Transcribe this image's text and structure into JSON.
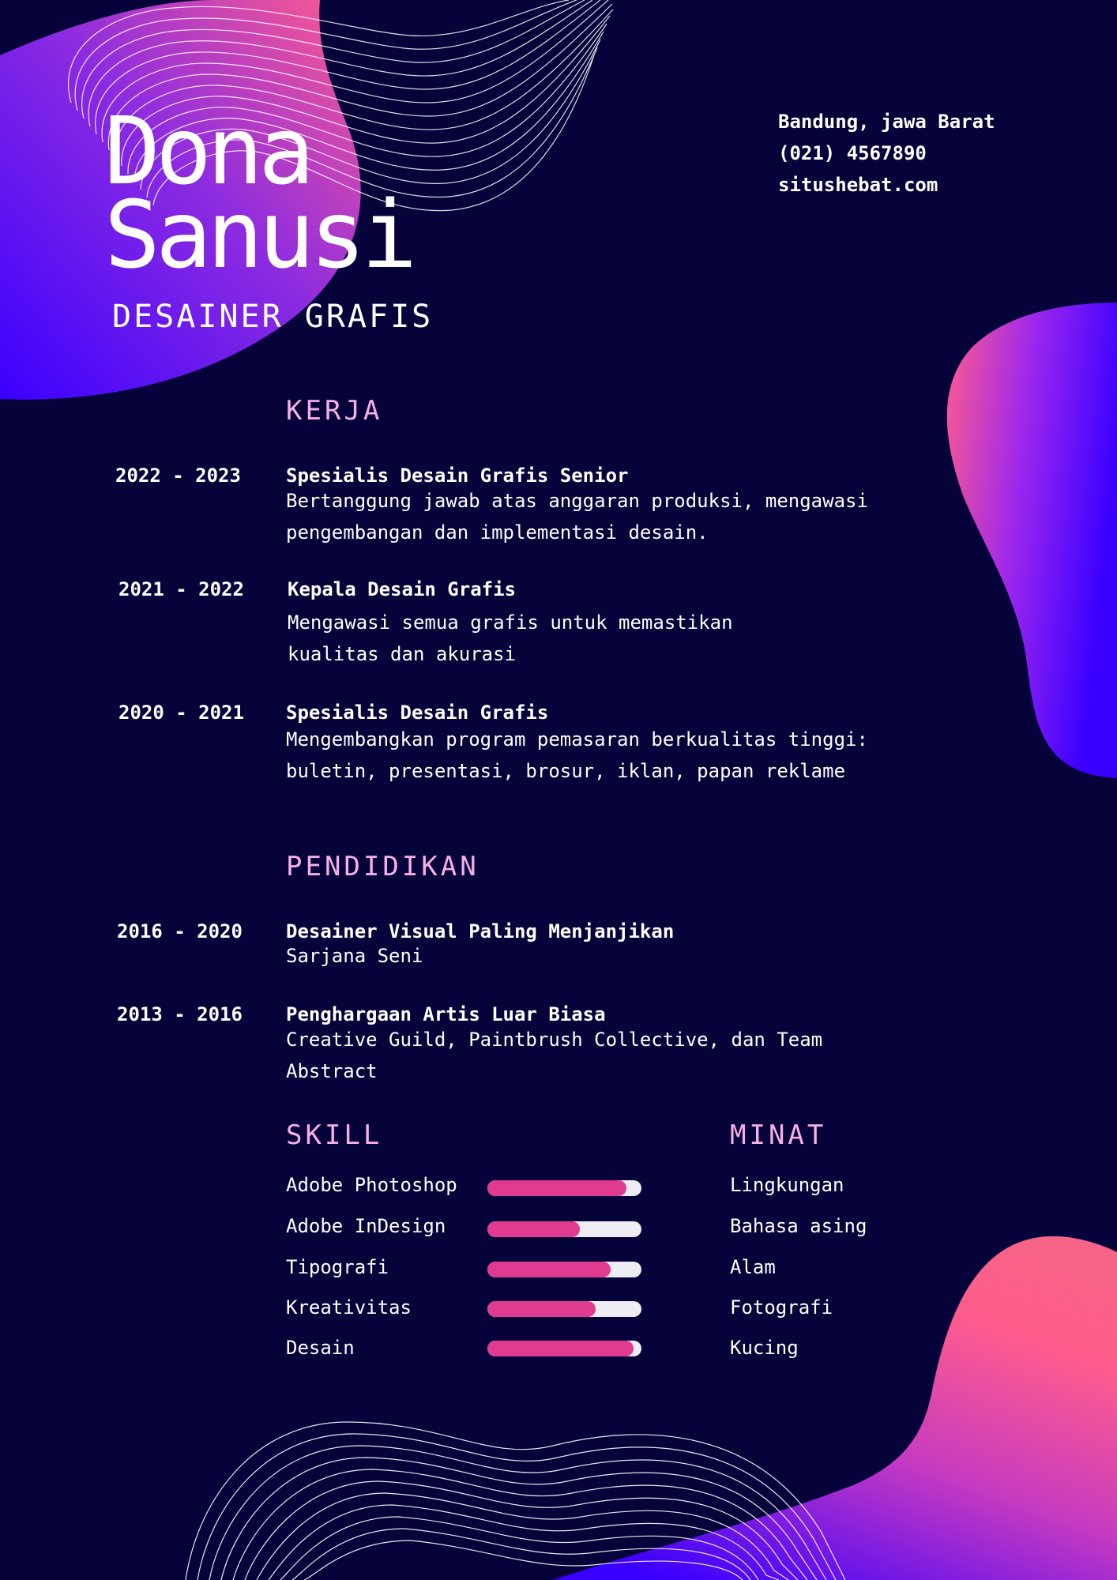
{
  "header": {
    "first_name": "Dona",
    "last_name": "Sanusi",
    "role": "DESAINER GRAFIS"
  },
  "contact": {
    "location": "Bandung, jawa Barat",
    "phone": "(021) 4567890",
    "website": "situshebat.com"
  },
  "work": {
    "title": "KERJA",
    "items": [
      {
        "years": "2022 - 2023",
        "title": "Spesialis Desain Grafis Senior",
        "desc": [
          "Bertanggung jawab atas anggaran produksi, mengawasi",
          "pengembangan dan implementasi desain."
        ]
      },
      {
        "years": "2021 - 2022",
        "title": "Kepala Desain Grafis",
        "desc": [
          "Mengawasi semua grafis untuk memastikan",
          "kualitas dan akurasi"
        ]
      },
      {
        "years": "2020 - 2021",
        "title": "Spesialis Desain Grafis",
        "desc": [
          "Mengembangkan program pemasaran berkualitas tinggi:",
          "buletin, presentasi, brosur, iklan, papan reklame"
        ]
      }
    ]
  },
  "education": {
    "title": "PENDIDIKAN",
    "items": [
      {
        "years": "2016 - 2020",
        "title": "Desainer Visual Paling Menjanjikan",
        "desc": [
          "Sarjana Seni"
        ]
      },
      {
        "years": "2013 - 2016",
        "title": "Penghargaan Artis Luar Biasa",
        "desc": [
          "Creative Guild, Paintbrush Collective, dan Team",
          "Abstract"
        ]
      }
    ]
  },
  "skills": {
    "title": "SKILL",
    "items": [
      {
        "label": "Adobe Photoshop",
        "level": 0.9
      },
      {
        "label": "Adobe InDesign",
        "level": 0.6
      },
      {
        "label": "Tipografi",
        "level": 0.8
      },
      {
        "label": "Kreativitas",
        "level": 0.7
      },
      {
        "label": "Desain",
        "level": 0.95
      }
    ]
  },
  "interests": {
    "title": "MINAT",
    "items": [
      "Lingkungan",
      "Bahasa asing",
      "Alam",
      "Fotografi",
      "Kucing"
    ]
  },
  "colors": {
    "background": "#06023a",
    "accent_pink": "#ff5c8d",
    "accent_blue": "#3a00ff",
    "bar_fill": "#e03a91",
    "section_title": "#f7b0e6"
  }
}
